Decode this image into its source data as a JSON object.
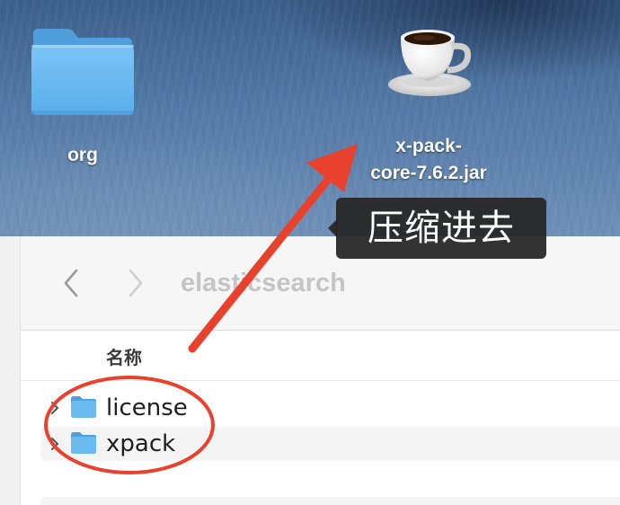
{
  "desktop": {
    "items": [
      {
        "label": "org",
        "icon": "folder-icon"
      },
      {
        "label": "x-pack-\ncore-7.6.2.jar",
        "icon": "java-cup-icon"
      }
    ]
  },
  "annotation": {
    "tooltip": "压缩进去",
    "arrow_color": "#e8412e",
    "circle_color": "#e8412e"
  },
  "finder": {
    "title": "elasticsearch",
    "nav": {
      "back": "chevron-left-icon",
      "forward": "chevron-right-icon"
    },
    "column_header": "名称",
    "rows": [
      {
        "name": "license",
        "icon": "folder-icon"
      },
      {
        "name": "xpack",
        "icon": "folder-icon"
      }
    ]
  },
  "colors": {
    "folder_blue": "#5fb2f0",
    "title_gray": "#c4c4c4"
  }
}
